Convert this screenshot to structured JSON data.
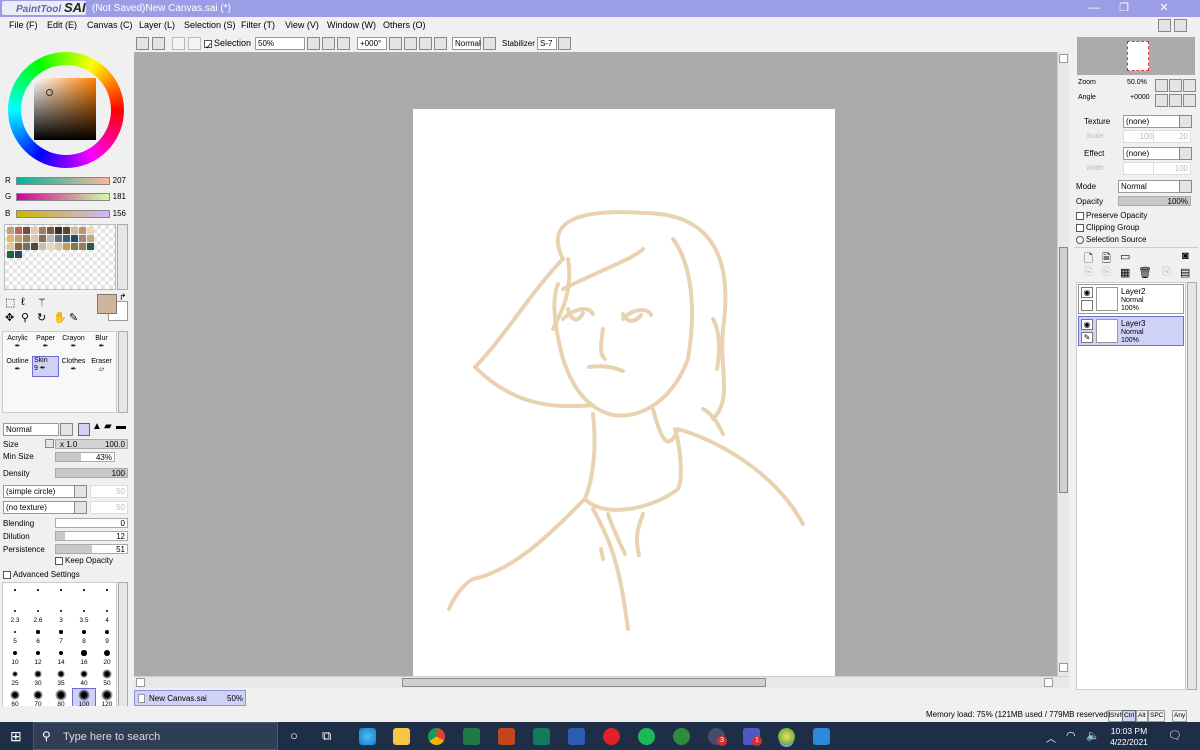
{
  "title_bar": {
    "app_logo": "PaintTool",
    "app_logo_bold": "SAI",
    "document_title": "(Not Saved)New Canvas.sai (*)",
    "min_glyph": "—",
    "max_glyph": "❐",
    "close_glyph": "✕"
  },
  "menu": [
    "File (F)",
    "Edit (E)",
    "Canvas (C)",
    "Layer (L)",
    "Selection (S)",
    "Filter (T)",
    "View (V)",
    "Window (W)",
    "Others (O)"
  ],
  "toolbar": {
    "selection_label": "Selection",
    "zoom": "50%",
    "angle": "+000°",
    "blend": "Normal",
    "stabilizer_label": "Stabilizer",
    "stabilizer": "S-7"
  },
  "color": {
    "r_label": "R",
    "r": "207",
    "g_label": "G",
    "g": "181",
    "b_label": "B",
    "b": "156",
    "current": "#cfb59c"
  },
  "swatches": [
    "#c89a80",
    "#b86a50",
    "#7b4c3a",
    "#e8c8b0",
    "#a57b60",
    "#7a5a44",
    "#3a2d28",
    "#5c4636",
    "#d8b890",
    "#b8956a",
    "#f0d8b0",
    "#e8b860",
    "#c8a070",
    "#a08050",
    "#d8c8b8",
    "#8c6a55",
    "#b8b8b8",
    "#5c7080",
    "#3c5c78",
    "#28486a",
    "#a08878",
    "#c8a880",
    "#e0c890",
    "#8a6040",
    "#707060",
    "#504838",
    "#c8c0a8",
    "#e8d8c0",
    "#d8c8a0",
    "#c0a050",
    "#7a8040",
    "#908060",
    "#2a5a48",
    "#1e6448",
    "#2a4a60"
  ],
  "tools": {
    "row1": [
      "Acrylic",
      "Paper",
      "Crayon",
      "Blur"
    ],
    "row2": [
      "Outline",
      "Skin",
      "Clothes",
      "Eraser"
    ],
    "skin_size": "9"
  },
  "brush": {
    "mode": "Normal",
    "size_label": "Size",
    "size_mult": "x 1.0",
    "size": "100.0",
    "minsize_label": "Min Size",
    "minsize": "43%",
    "density_label": "Density",
    "density": "100",
    "shape": "(simple circle)",
    "shape_val": "50",
    "texture": "(no texture)",
    "texture_val": "50",
    "blending_label": "Blending",
    "blending": "0",
    "dilution_label": "Dilution",
    "dilution": "12",
    "persistence_label": "Persistence",
    "persistence": "51",
    "keep_opacity": "Keep Opacity",
    "advanced": "Advanced Settings"
  },
  "brush_sizes": [
    [
      "",
      "",
      "",
      "",
      ""
    ],
    [
      "2.3",
      "2.6",
      "3",
      "3.5",
      "4"
    ],
    [
      "5",
      "6",
      "7",
      "8",
      "9"
    ],
    [
      "10",
      "12",
      "14",
      "16",
      "20"
    ],
    [
      "25",
      "30",
      "35",
      "40",
      "50"
    ],
    [
      "60",
      "70",
      "80",
      "100",
      "120"
    ]
  ],
  "navigator": {
    "zoom_label": "Zoom",
    "zoom": "50.0%",
    "angle_label": "Angle",
    "angle": "+0000"
  },
  "layer_panel": {
    "texture_label": "Texture",
    "texture": "(none)",
    "scale_label": "Scale",
    "scale": "100%",
    "scale2": "20",
    "effect_label": "Effect",
    "effect": "(none)",
    "width_label": "Width",
    "width": "1",
    "width2": "100",
    "mode_label": "Mode",
    "mode": "Normal",
    "opacity_label": "Opacity",
    "opacity": "100%",
    "preserve": "Preserve Opacity",
    "clipping": "Clipping Group",
    "selsource": "Selection Source"
  },
  "layers": [
    {
      "name": "Layer2",
      "mode": "Normal",
      "opacity": "100%"
    },
    {
      "name": "Layer3",
      "mode": "Normal",
      "opacity": "100%"
    }
  ],
  "canvas_tab": {
    "name": "New Canvas.sai",
    "zoom": "50%"
  },
  "status": {
    "memory": "Memory load: 75% (121MB used / 779MB reserved)",
    "keys": [
      "Shift",
      "Ctrl",
      "Alt",
      "SPC",
      "Any"
    ]
  },
  "taskbar": {
    "search": "Type here to search",
    "time": "10:03 PM",
    "date": "4/22/2021",
    "badge_a": "3",
    "badge_b": "1"
  }
}
